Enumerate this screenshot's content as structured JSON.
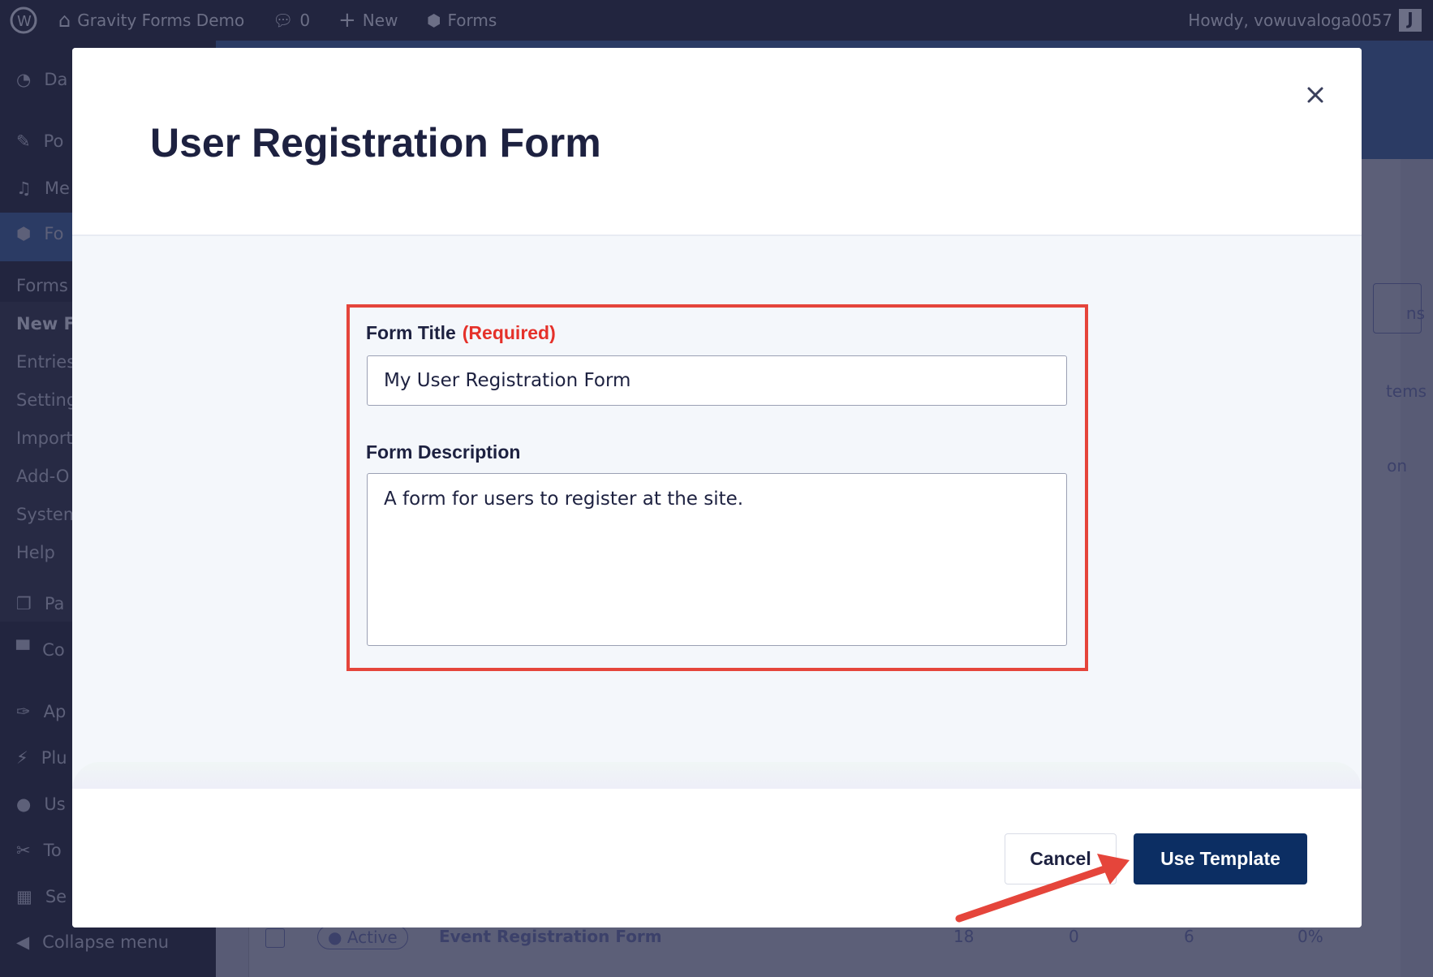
{
  "admin_bar": {
    "site_name": "Gravity Forms Demo",
    "comments_count": "0",
    "new_label": "New",
    "forms_label": "Forms",
    "howdy": "Howdy, vowuvaloga0057"
  },
  "sidebar": {
    "items": [
      {
        "label": "Da",
        "icon": "dashboard-icon"
      },
      {
        "label": "Po",
        "icon": "pin-icon"
      },
      {
        "label": "Me",
        "icon": "media-icon"
      },
      {
        "label": "Fo",
        "icon": "gravity-forms-icon"
      }
    ],
    "submenu": [
      "Forms",
      "New Fo",
      "Entries",
      "Setting",
      "Import/",
      "Add-O",
      "System",
      "Help"
    ],
    "items2": [
      {
        "label": "Pa",
        "icon": "pages-icon"
      },
      {
        "label": "Co",
        "icon": "comments-icon"
      },
      {
        "label": "Ap",
        "icon": "appearance-icon"
      },
      {
        "label": "Plu",
        "icon": "plugins-icon"
      },
      {
        "label": "Us",
        "icon": "users-icon"
      },
      {
        "label": "To",
        "icon": "tools-icon"
      },
      {
        "label": "Se",
        "icon": "settings-icon"
      }
    ],
    "collapse": "Collapse menu"
  },
  "background": {
    "button_fragment": "ns",
    "items_fragment": "tems",
    "col_fragment": "on",
    "row": {
      "status": "Active",
      "name": "Event Registration Form",
      "c1": "18",
      "c2": "0",
      "c3": "6",
      "c4": "0%"
    }
  },
  "modal": {
    "title": "User Registration Form",
    "form_title_label": "Form Title",
    "required": "(Required)",
    "form_title_value": "My User Registration Form",
    "form_description_label": "Form Description",
    "form_description_value": "A form for users to register at the site.",
    "cancel": "Cancel",
    "use_template": "Use Template"
  },
  "colors": {
    "accent": "#0c2e63",
    "highlight": "#e5453b",
    "required": "#e5312a"
  }
}
